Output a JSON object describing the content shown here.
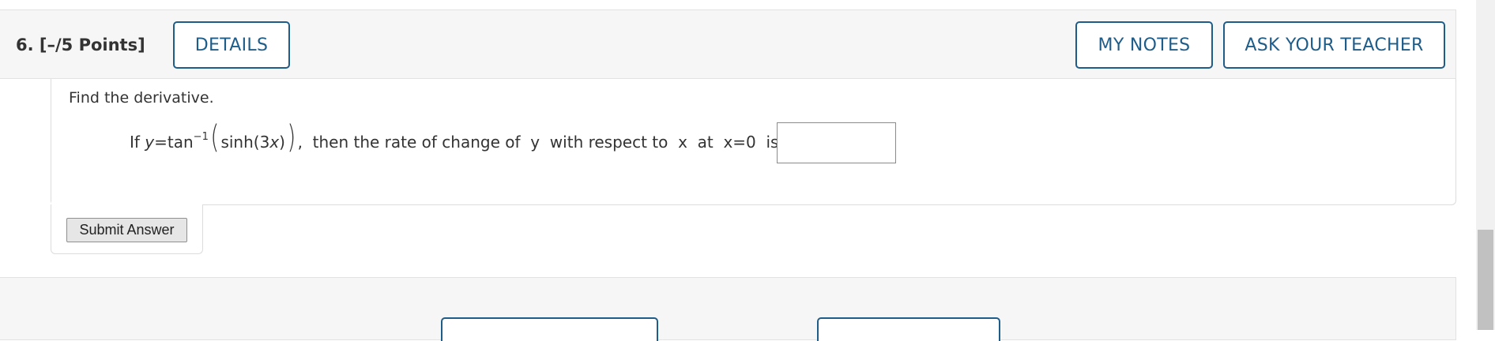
{
  "question": {
    "number_label": "6.  [–/5 Points]",
    "details_label": "DETAILS",
    "my_notes_label": "MY NOTES",
    "ask_teacher_label": "ASK YOUR TEACHER",
    "instruction": "Find the derivative.",
    "math": {
      "if": "If ",
      "y": "y",
      "eq_tan": "=tan",
      "exp": "−1",
      "lparen": "(",
      "sinh": "sinh(3",
      "x": "x",
      "close": ")",
      "rparen": ")",
      "then": ",  then the rate of change of  y  with respect to  x  at  x=0  is "
    },
    "answer_value": "",
    "submit_label": "Submit Answer"
  },
  "colors": {
    "accent": "#1e5c8a",
    "header_bg": "#f6f6f6"
  }
}
